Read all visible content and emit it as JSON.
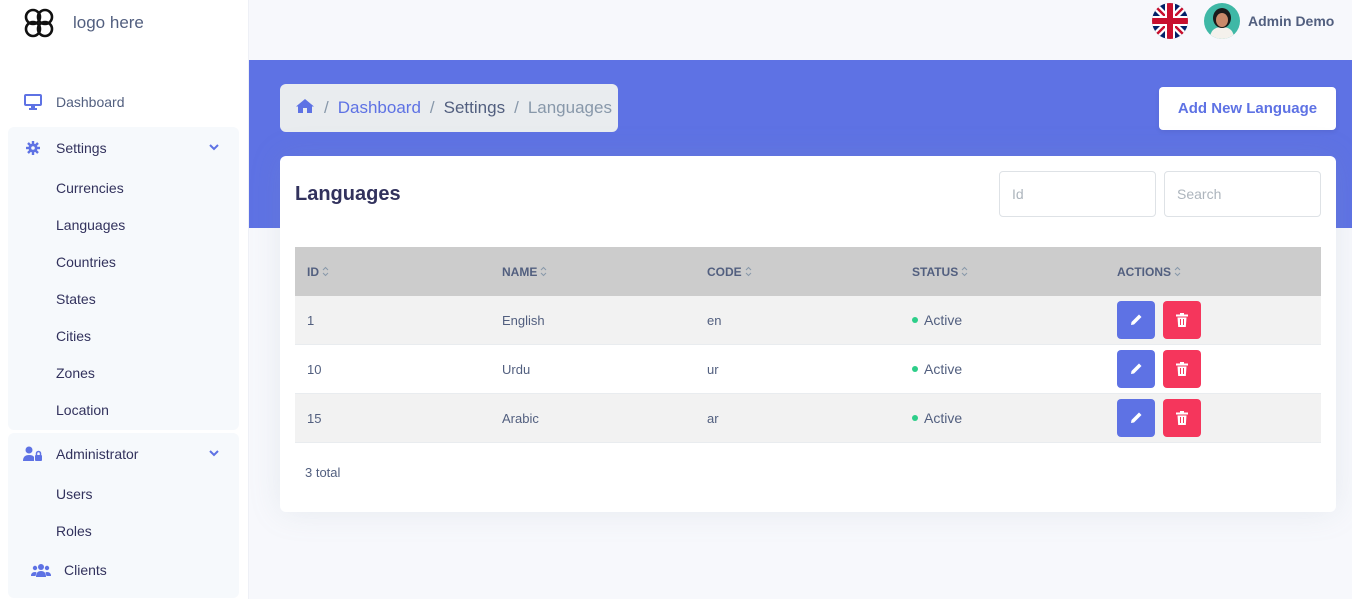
{
  "brand": {
    "logo_text": "logo here"
  },
  "sidebar": {
    "dashboard": {
      "label": "Dashboard",
      "icon": "monitor-icon"
    },
    "settings": {
      "label": "Settings",
      "icon": "gear-icon",
      "items": [
        "Currencies",
        "Languages",
        "Countries",
        "States",
        "Cities",
        "Zones",
        "Location"
      ]
    },
    "administrator": {
      "label": "Administrator",
      "icon": "user-lock-icon",
      "items": [
        "Users",
        "Roles"
      ]
    },
    "clients": {
      "label": "Clients",
      "icon": "users-icon"
    }
  },
  "topbar": {
    "user_name": "Admin Demo",
    "language_flag": "uk-flag-icon"
  },
  "breadcrumb": {
    "home_icon": "home-icon",
    "items": [
      "Dashboard",
      "Settings",
      "Languages"
    ]
  },
  "actions": {
    "add_new": "Add New Language"
  },
  "card": {
    "title": "Languages",
    "filters": {
      "id_placeholder": "Id",
      "search_placeholder": "Search"
    },
    "columns": [
      "ID",
      "NAME",
      "CODE",
      "STATUS",
      "ACTIONS"
    ],
    "rows": [
      {
        "id": "1",
        "name": "English",
        "code": "en",
        "status": "Active"
      },
      {
        "id": "10",
        "name": "Urdu",
        "code": "ur",
        "status": "Active"
      },
      {
        "id": "15",
        "name": "Arabic",
        "code": "ar",
        "status": "Active"
      }
    ],
    "total": "3 total"
  },
  "colors": {
    "primary": "#5e72e4",
    "danger": "#f5365c",
    "success": "#2dce89",
    "header_bg": "#cccccc"
  }
}
